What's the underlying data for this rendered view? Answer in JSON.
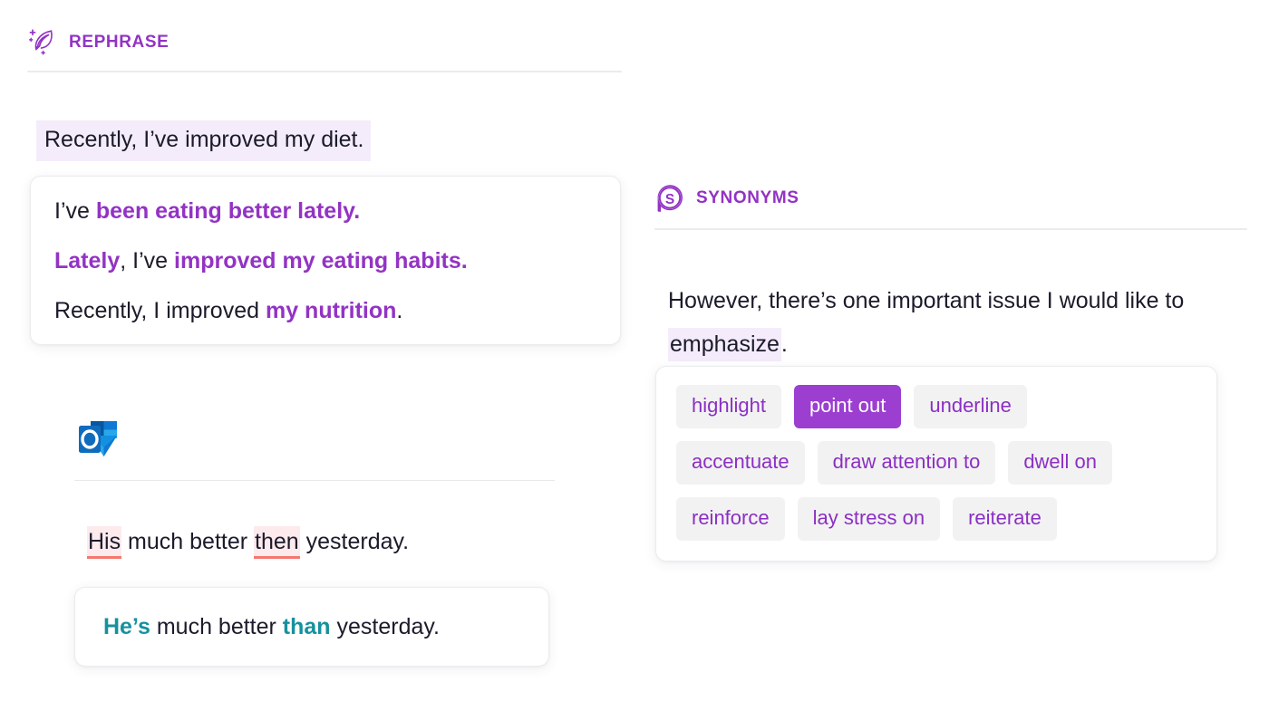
{
  "rephrase": {
    "title": "REPHRASE",
    "icon": "quill-sparkle-icon",
    "accent_color": "#9333c4",
    "original_sentence": "Recently, I’ve improved my diet.",
    "suggestions": [
      {
        "parts": [
          {
            "t": "I’ve ",
            "hl": false
          },
          {
            "t": "been eating better lately.",
            "hl": true
          }
        ]
      },
      {
        "parts": [
          {
            "t": "Lately",
            "hl": true
          },
          {
            "t": ", I’ve ",
            "hl": false
          },
          {
            "t": "improved my eating habits.",
            "hl": true
          }
        ]
      },
      {
        "parts": [
          {
            "t": "Recently, I improved ",
            "hl": false
          },
          {
            "t": "my nutrition",
            "hl": true
          },
          {
            "t": ".",
            "hl": false
          }
        ]
      }
    ]
  },
  "grammar": {
    "app_icon": "microsoft-outlook-icon",
    "sentence_parts": [
      {
        "t": "His",
        "error": true
      },
      {
        "t": " much better ",
        "error": false
      },
      {
        "t": "then",
        "error": true
      },
      {
        "t": " yesterday.",
        "error": false
      }
    ],
    "correction_parts": [
      {
        "t": "He’s",
        "fix": true
      },
      {
        "t": " much better ",
        "fix": false
      },
      {
        "t": "than",
        "fix": true
      },
      {
        "t": " yesterday.",
        "fix": false
      }
    ],
    "error_color": "#f4786f",
    "error_background": "#fdeaed",
    "fix_color": "#16919e"
  },
  "synonyms": {
    "title": "SYNONYMS",
    "icon": "synonyms-bubble-s-icon",
    "accent_color": "#9333c4",
    "sentence_before": "However, there’s one important issue I would like to ",
    "target_word": "emphasize",
    "sentence_after": ".",
    "selected": "point out",
    "rows": [
      [
        "highlight",
        "point out",
        "underline"
      ],
      [
        "accentuate",
        "draw attention to",
        "dwell on"
      ],
      [
        "reinforce",
        "lay stress on",
        "reiterate"
      ]
    ]
  }
}
